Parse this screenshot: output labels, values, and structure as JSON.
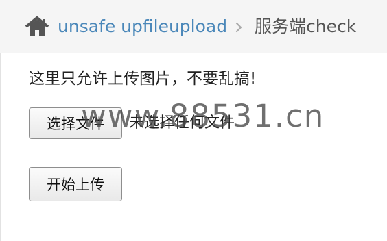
{
  "breadcrumb": {
    "home_icon": "home-icon",
    "link_label": "unsafe upfileupload",
    "separator_icon": "chevron-right-icon",
    "current_label": "服务端check"
  },
  "content": {
    "notice": "这里只允许上传图片，不要乱搞!",
    "file_input": {
      "button_label": "选择文件",
      "status_text": "未选择任何文件"
    },
    "upload_button_label": "开始上传"
  },
  "watermark": "www.88531.cn",
  "colors": {
    "link": "#4a87b9",
    "breadcrumb_bg": "#f5f5f5",
    "text": "#222222"
  }
}
